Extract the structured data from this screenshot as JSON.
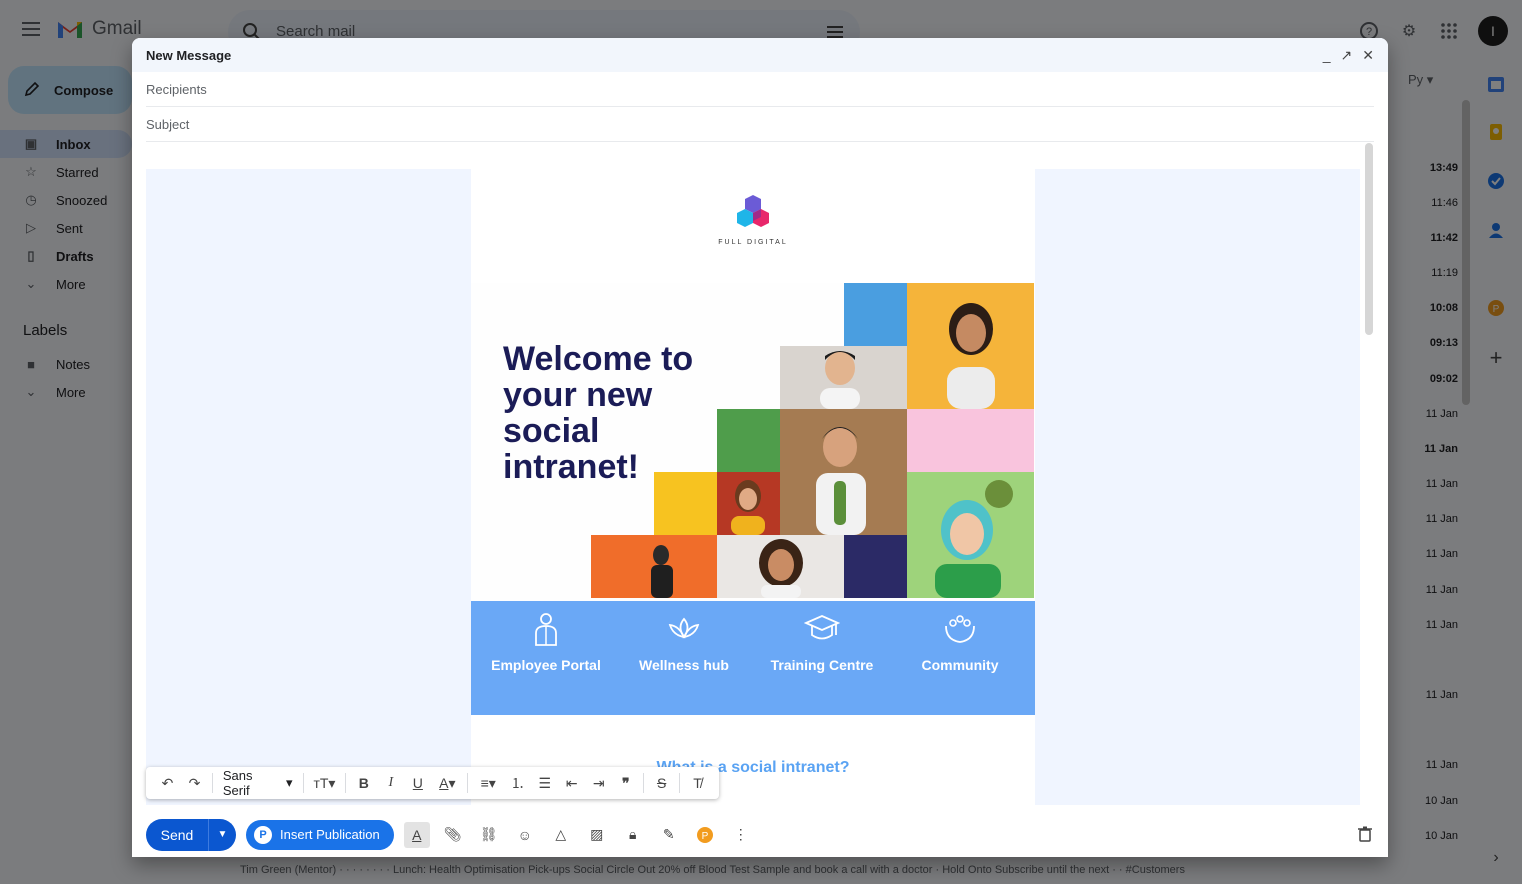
{
  "app": {
    "name": "Gmail"
  },
  "search": {
    "placeholder": "Search mail"
  },
  "header": {
    "avatar_letter": "I"
  },
  "sidebar": {
    "compose_label": "Compose",
    "items": [
      {
        "label": "Inbox",
        "icon": "inbox-icon",
        "active": true
      },
      {
        "label": "Starred",
        "icon": "star-icon"
      },
      {
        "label": "Snoozed",
        "icon": "clock-icon"
      },
      {
        "label": "Sent",
        "icon": "send-icon"
      },
      {
        "label": "Drafts",
        "icon": "file-icon"
      },
      {
        "label": "More",
        "icon": "chevron-down-icon"
      }
    ],
    "labels_title": "Labels",
    "label_items": [
      {
        "label": "Notes",
        "icon": "label-icon"
      },
      {
        "label": "More",
        "icon": "chevron-down-icon"
      }
    ]
  },
  "mail_list": {
    "language_selector": "Ру",
    "times": [
      {
        "text": "13:49",
        "bold": true
      },
      {
        "text": "11:46",
        "bold": false
      },
      {
        "text": "11:42",
        "bold": true
      },
      {
        "text": "11:19",
        "bold": false
      },
      {
        "text": "10:08",
        "bold": true
      },
      {
        "text": "09:13",
        "bold": true
      },
      {
        "text": "09:02",
        "bold": true
      },
      {
        "text": "11 Jan",
        "bold": false
      },
      {
        "text": "11 Jan",
        "bold": true
      },
      {
        "text": "11 Jan",
        "bold": false
      },
      {
        "text": "11 Jan",
        "bold": false
      },
      {
        "text": "11 Jan",
        "bold": false
      },
      {
        "text": "11 Jan",
        "bold": false
      },
      {
        "text": "11 Jan",
        "bold": false
      },
      {
        "text": "11 Jan",
        "bold": false
      },
      {
        "text": "11 Jan",
        "bold": false
      },
      {
        "text": "10 Jan",
        "bold": false
      },
      {
        "text": "10 Jan",
        "bold": false
      }
    ],
    "bottom_row_text": "Tim Green (Mentor) · · · · · · · · Lunch: Health Optimisation Pick-ups Social Circle Out 20% off Blood Test Sample and book a call with a doctor · Hold Onto Subscribe until the next · · #Customers"
  },
  "compose": {
    "title": "New Message",
    "recipients_placeholder": "Recipients",
    "subject_placeholder": "Subject",
    "newsletter": {
      "brand": "FULL DIGITAL",
      "headline": "Welcome to your new social intranet!",
      "features": [
        {
          "label": "Employee Portal",
          "icon": "employee-icon"
        },
        {
          "label": "Wellness hub",
          "icon": "lotus-icon"
        },
        {
          "label": "Training Centre",
          "icon": "graduation-cap-icon"
        },
        {
          "label": "Community",
          "icon": "community-hands-icon"
        }
      ],
      "question": "What is a social intranet?"
    },
    "format_bar": {
      "font": "Sans Serif"
    },
    "footer": {
      "send_label": "Send",
      "insert_publication_label": "Insert Publication"
    }
  },
  "colors": {
    "accent": "#0b57d0",
    "newsletter_blue": "#6aa8f6",
    "headline_navy": "#1b1c57",
    "compose_bg": "#f0f5ff"
  }
}
